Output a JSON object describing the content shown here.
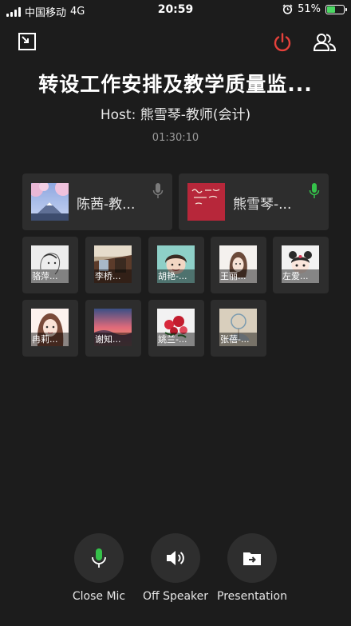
{
  "status_bar": {
    "carrier": "中国移动",
    "network": "4G",
    "time": "20:59",
    "battery_percent": "51%",
    "battery_level": 0.51
  },
  "meeting": {
    "title": "转设工作安排及教学质量监...",
    "host_line": "Host: 熊雪琴-教师(会计)",
    "elapsed": "01:30:10"
  },
  "featured": [
    {
      "name": "陈茜-教...",
      "mic_active": false,
      "mic_color": "#7a7a7a"
    },
    {
      "name": "熊雪琴-...",
      "mic_active": true,
      "mic_color": "#35c24a"
    }
  ],
  "participants": [
    {
      "name": "骆萍..."
    },
    {
      "name": "李桥..."
    },
    {
      "name": "胡艳-..."
    },
    {
      "name": "王丽..."
    },
    {
      "name": "左爱..."
    },
    {
      "name": "冉莉..."
    },
    {
      "name": "谢知..."
    },
    {
      "name": "姚兰-..."
    },
    {
      "name": "张蓓-..."
    }
  ],
  "controls": {
    "mic_label": "Close Mic",
    "speaker_label": "Off Speaker",
    "presentation_label": "Presentation"
  },
  "colors": {
    "background": "#1c1c1c",
    "tile": "#2d2d2d",
    "end_call": "#e5413b",
    "mic_active": "#35c24a"
  }
}
